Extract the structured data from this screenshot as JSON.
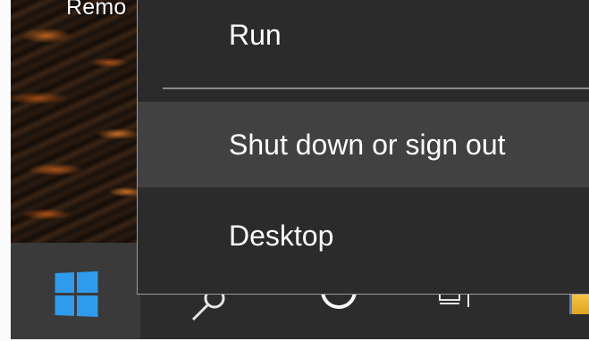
{
  "desktop": {
    "icon_label": "Remo"
  },
  "context_menu": {
    "items": [
      {
        "label": "Run"
      },
      {
        "label": "Shut down or sign out"
      },
      {
        "label": "Desktop"
      }
    ]
  },
  "taskbar": {
    "start_icon": "windows-logo-icon",
    "buttons": [
      "search-icon",
      "cortana-icon",
      "task-view-icon",
      "file-explorer-icon"
    ]
  },
  "colors": {
    "menu_bg": "#2b2b2b",
    "menu_hover": "#414141",
    "taskbar_bg": "#2c2c2c",
    "windows_blue": "#2e9bec"
  }
}
